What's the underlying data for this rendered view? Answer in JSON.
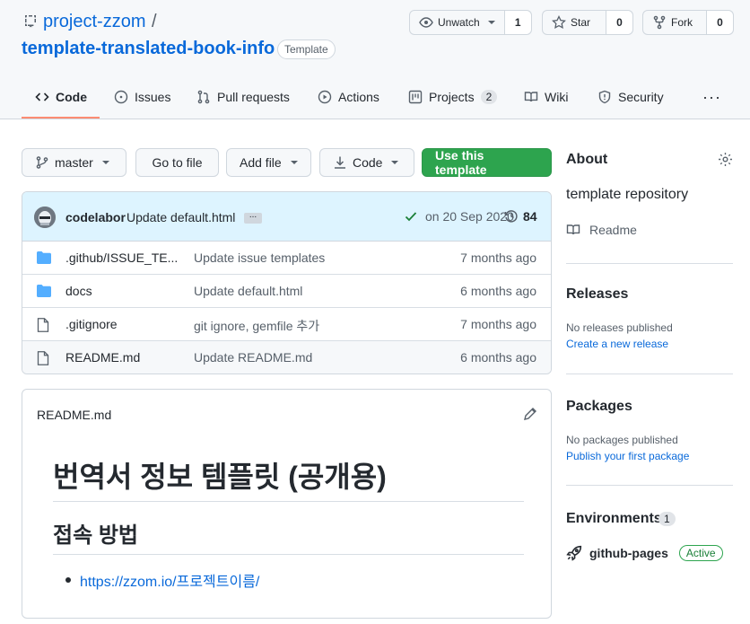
{
  "repo": {
    "owner": "project-zzom",
    "separator": "/",
    "name": "template-translated-book-info",
    "badge": "Template"
  },
  "actions": {
    "unwatch_label": "Unwatch",
    "unwatch_count": "1",
    "star_label": "Star",
    "star_count": "0",
    "fork_label": "Fork",
    "fork_count": "0"
  },
  "tabs": {
    "code": "Code",
    "issues": "Issues",
    "pull_requests": "Pull requests",
    "actions": "Actions",
    "projects": "Projects",
    "projects_count": "2",
    "wiki": "Wiki",
    "security": "Security",
    "more": "···"
  },
  "toolbar": {
    "branch": "master",
    "go_to_file": "Go to file",
    "add_file": "Add file",
    "code": "Code",
    "use_template": "Use this template"
  },
  "commit": {
    "author": "codelabor",
    "message": "Update default.html",
    "ellipsis": "...",
    "date": "on 20 Sep 2020",
    "count": "84"
  },
  "files": [
    {
      "name": ".github/ISSUE_TE...",
      "message": "Update issue templates",
      "age": "7 months ago",
      "type": "folder"
    },
    {
      "name": "docs",
      "message": "Update default.html",
      "age": "6 months ago",
      "type": "folder"
    },
    {
      "name": ".gitignore",
      "message": "git ignore, gemfile 추가",
      "age": "7 months ago",
      "type": "file"
    },
    {
      "name": "README.md",
      "message": "Update README.md",
      "age": "6 months ago",
      "type": "file"
    }
  ],
  "readme": {
    "title": "README.md",
    "h1": "번역서 정보 템플릿 (공개용)",
    "h2": "접속 방법",
    "link": "https://zzom.io/프로젝트이름/"
  },
  "sidebar": {
    "about_title": "About",
    "about_desc": "template repository",
    "readme_label": "Readme",
    "releases_title": "Releases",
    "releases_none": "No releases published",
    "releases_link": "Create a new release",
    "packages_title": "Packages",
    "packages_none": "No packages published",
    "packages_link": "Publish your first package",
    "env_title": "Environments",
    "env_count": "1",
    "env_name": "github-pages",
    "env_status": "Active"
  },
  "colors": {
    "link": "#0969da",
    "primary_button": "#2da44e",
    "tab_underline": "#fd8c73",
    "commit_bar": "#ddf4ff",
    "folder": "#54aeff"
  }
}
